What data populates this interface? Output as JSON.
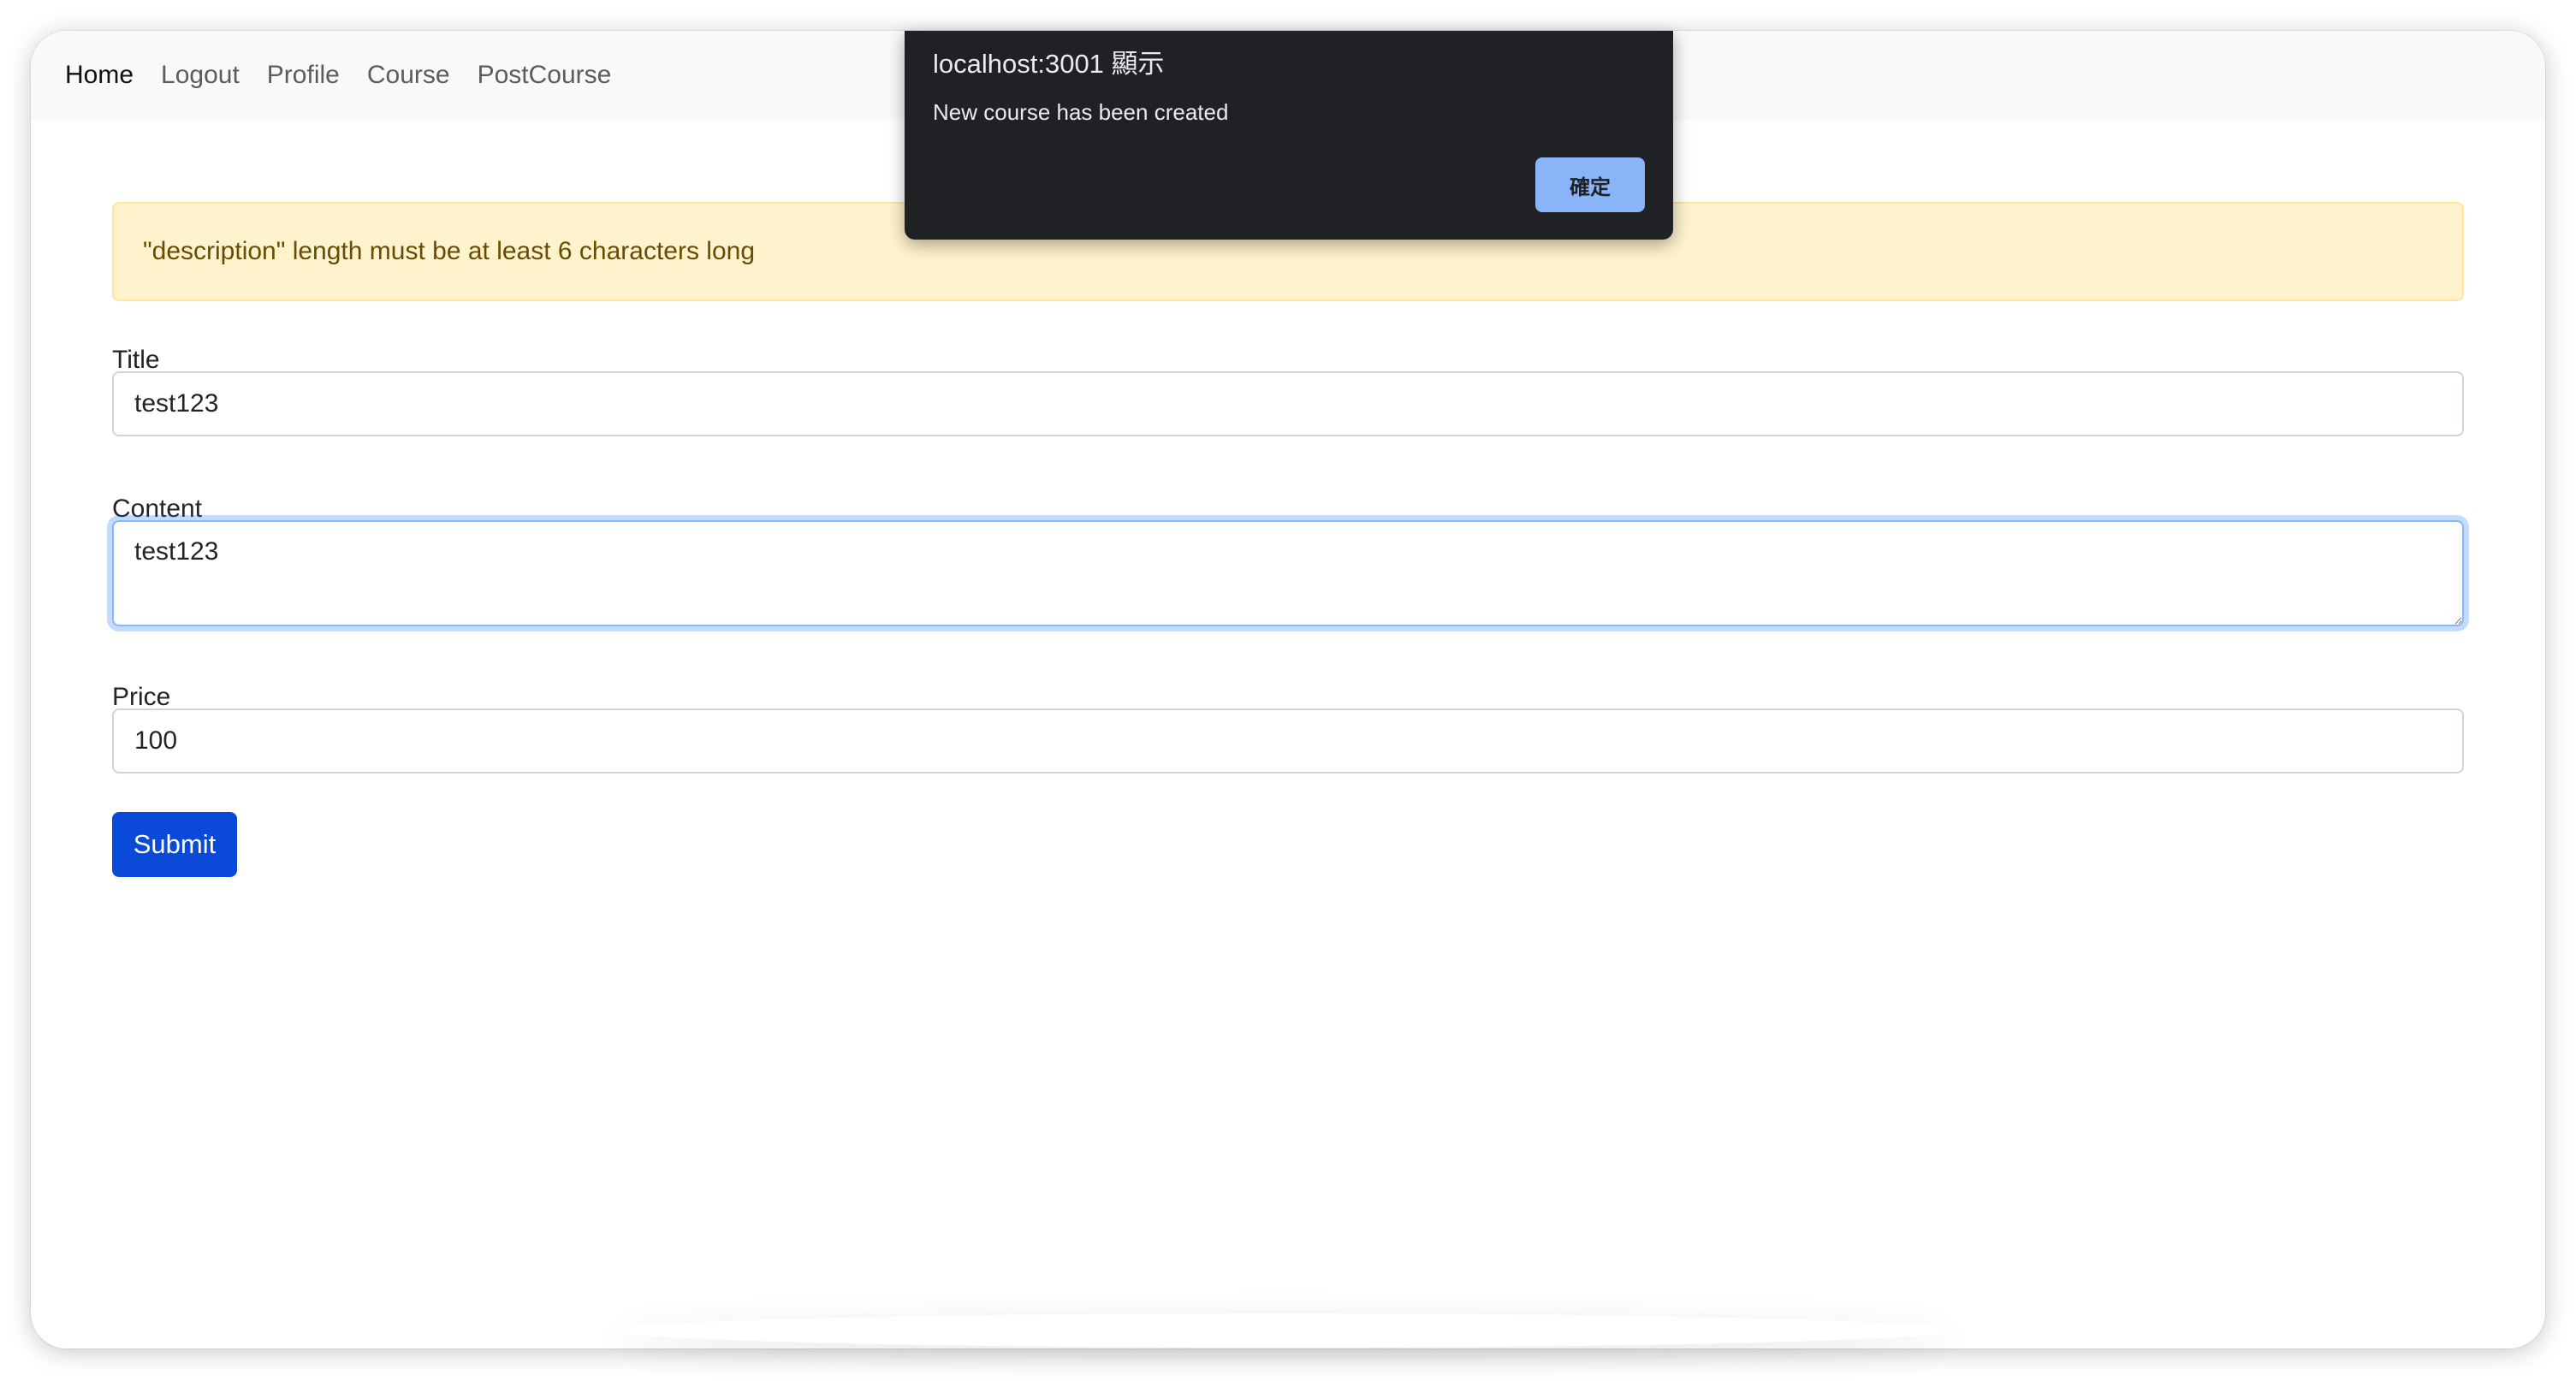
{
  "navbar": {
    "links": [
      "Home",
      "Logout",
      "Profile",
      "Course",
      "PostCourse"
    ]
  },
  "alert": {
    "message": "\"description\" length must be at least 6 characters long"
  },
  "form": {
    "title_label": "Title",
    "title_value": "test123",
    "content_label": "Content",
    "content_value": "test123",
    "price_label": "Price",
    "price_value": "100",
    "submit_label": "Submit"
  },
  "dialog": {
    "title": "localhost:3001 顯示",
    "message": "New course has been created",
    "ok_label": "確定"
  },
  "colors": {
    "alert_background": "#fff3cd",
    "submit_button": "#0b49d9",
    "dialog_background": "#202124",
    "dialog_button": "#8ab4f8"
  }
}
